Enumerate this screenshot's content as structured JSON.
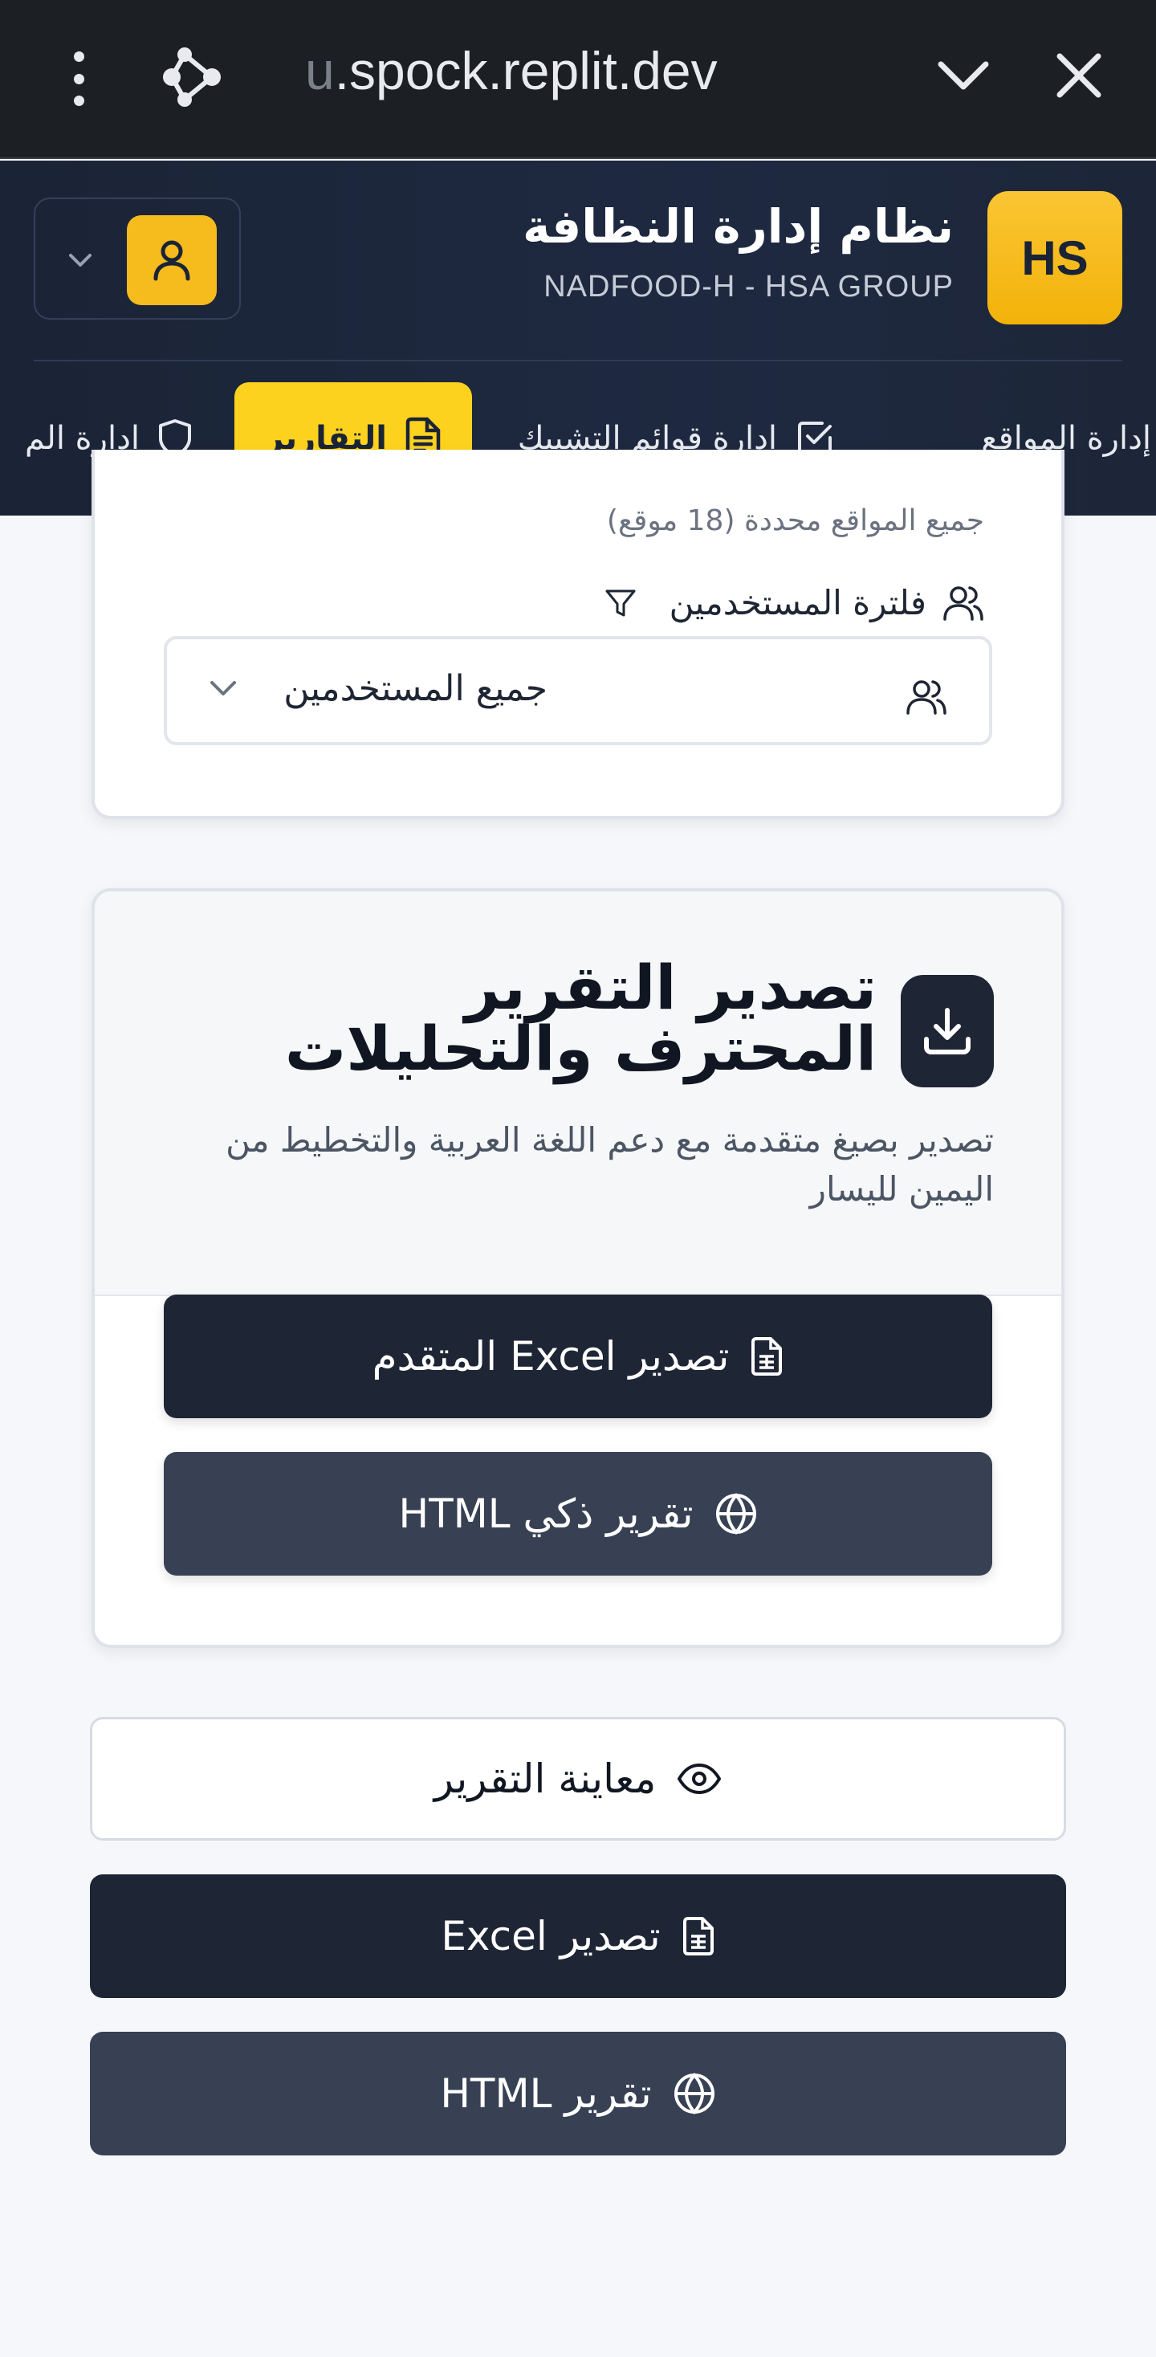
{
  "browser": {
    "url_faded": "u",
    "url_main": ".spock.replit.dev"
  },
  "header": {
    "logo_text": "HS",
    "title": "نظام إدارة النظافة",
    "subtitle": "NADFOOD-H - HSA GROUP"
  },
  "nav": {
    "tabs": [
      {
        "label": "إدارة المواقع",
        "icon": "map-pin-icon"
      },
      {
        "label": "إدارة قوائم التشييك",
        "icon": "checkbox-icon"
      },
      {
        "label": "التقارير",
        "icon": "file-text-icon",
        "active": true
      },
      {
        "label": "إدارة الم",
        "icon": "shield-icon"
      }
    ]
  },
  "filters": {
    "sites_summary": "جميع المواقع محددة (18 موقع)",
    "users_filter_label": "فلترة المستخدمين",
    "users_select_value": "جميع المستخدمين"
  },
  "export_card": {
    "title": "تصدير التقرير المحترف والتحليلات",
    "subtitle": "تصدير بصيغ متقدمة مع دعم اللغة العربية والتخطيط من اليمين لليسار",
    "excel_advanced_label": "تصدير Excel المتقدم",
    "html_smart_label": "تقرير ذكي HTML"
  },
  "actions": {
    "preview_label": "معاينة التقرير",
    "excel_label": "تصدير Excel",
    "html_label": "تقرير HTML"
  },
  "colors": {
    "header_bg": "#1b2436",
    "accent_yellow": "#fdd21e",
    "button_dark": "#1e2535",
    "button_slate": "#384153"
  }
}
